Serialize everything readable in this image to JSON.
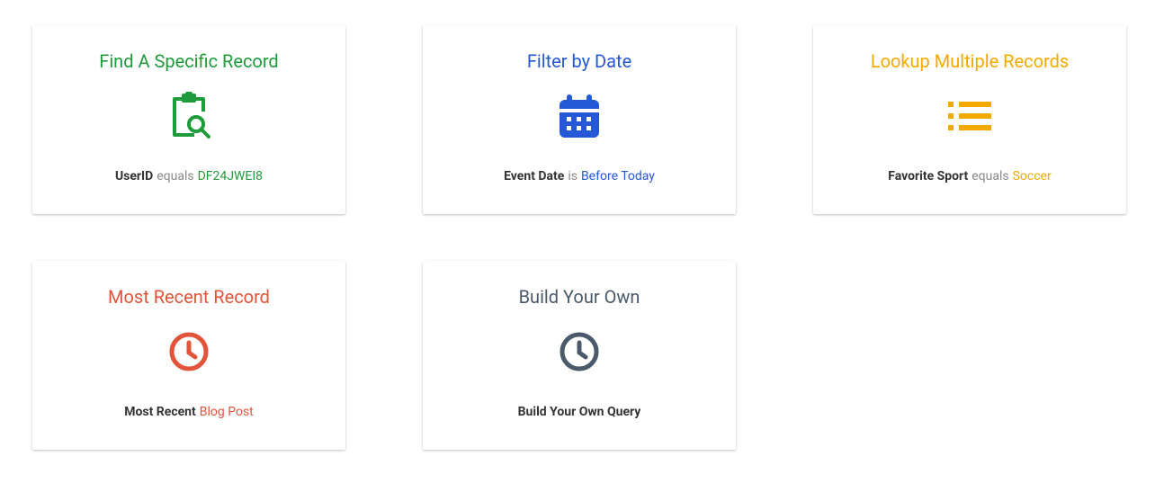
{
  "cards": [
    {
      "title": "Find A Specific Record",
      "desc_field": "UserID",
      "desc_op": "equals",
      "desc_val": "DF24JWEI8"
    },
    {
      "title": "Filter by Date",
      "desc_field": "Event Date",
      "desc_op": "is",
      "desc_val": "Before Today"
    },
    {
      "title": "Lookup Multiple Records",
      "desc_field": "Favorite Sport",
      "desc_op": "equals",
      "desc_val": "Soccer"
    },
    {
      "title": "Most Recent Record",
      "desc_field": "Most Recent",
      "desc_op": "",
      "desc_val": "Blog Post"
    },
    {
      "title": "Build Your Own",
      "desc_field": "Build Your Own Query",
      "desc_op": "",
      "desc_val": ""
    }
  ]
}
